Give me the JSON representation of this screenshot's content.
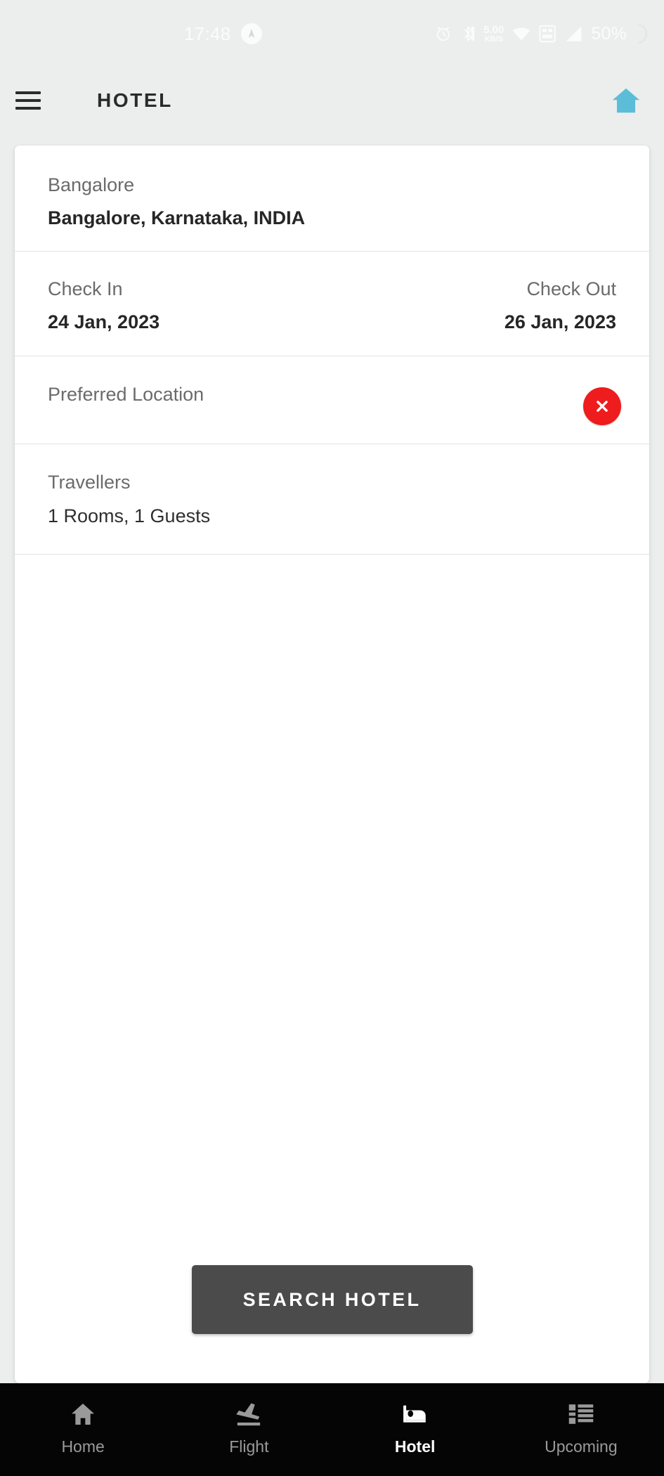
{
  "status_bar": {
    "time": "17:48",
    "nav_badge_icon": "navigation-icon",
    "alarm_icon": "alarm-clock-icon",
    "bluetooth_icon": "bluetooth-icon",
    "network_speed_value": "5.00",
    "network_speed_unit": "KB/S",
    "wifi_icon": "wifi-icon",
    "dual_sim_icon": "dual-sim-lte-icon",
    "signal_icon": "signal-bars-icon",
    "battery_percent": "50%",
    "battery_icon": "battery-charging-icon"
  },
  "app_bar": {
    "menu_icon": "hamburger-menu-icon",
    "title": "HOTEL",
    "home_icon": "home-icon",
    "home_icon_color": "#5bbdd8"
  },
  "form": {
    "destination": {
      "label": "Bangalore",
      "value": "Bangalore, Karnataka, INDIA"
    },
    "check_in": {
      "label": "Check In",
      "value": "24 Jan, 2023"
    },
    "check_out": {
      "label": "Check Out",
      "value": "26 Jan, 2023"
    },
    "preferred_location": {
      "label": "Preferred Location",
      "clear_icon": "close-x-icon",
      "clear_icon_color": "#ee1c1c"
    },
    "travellers": {
      "label": "Travellers",
      "value": "1 Rooms, 1 Guests"
    }
  },
  "search_button": {
    "label": "SEARCH HOTEL",
    "background": "#4b4b4b"
  },
  "bottom_nav": {
    "items": [
      {
        "label": "Home",
        "icon": "home-icon",
        "active": false
      },
      {
        "label": "Flight",
        "icon": "flight-takeoff-icon",
        "active": false
      },
      {
        "label": "Hotel",
        "icon": "bed-icon",
        "active": true
      },
      {
        "label": "Upcoming",
        "icon": "list-icon",
        "active": false
      }
    ]
  }
}
